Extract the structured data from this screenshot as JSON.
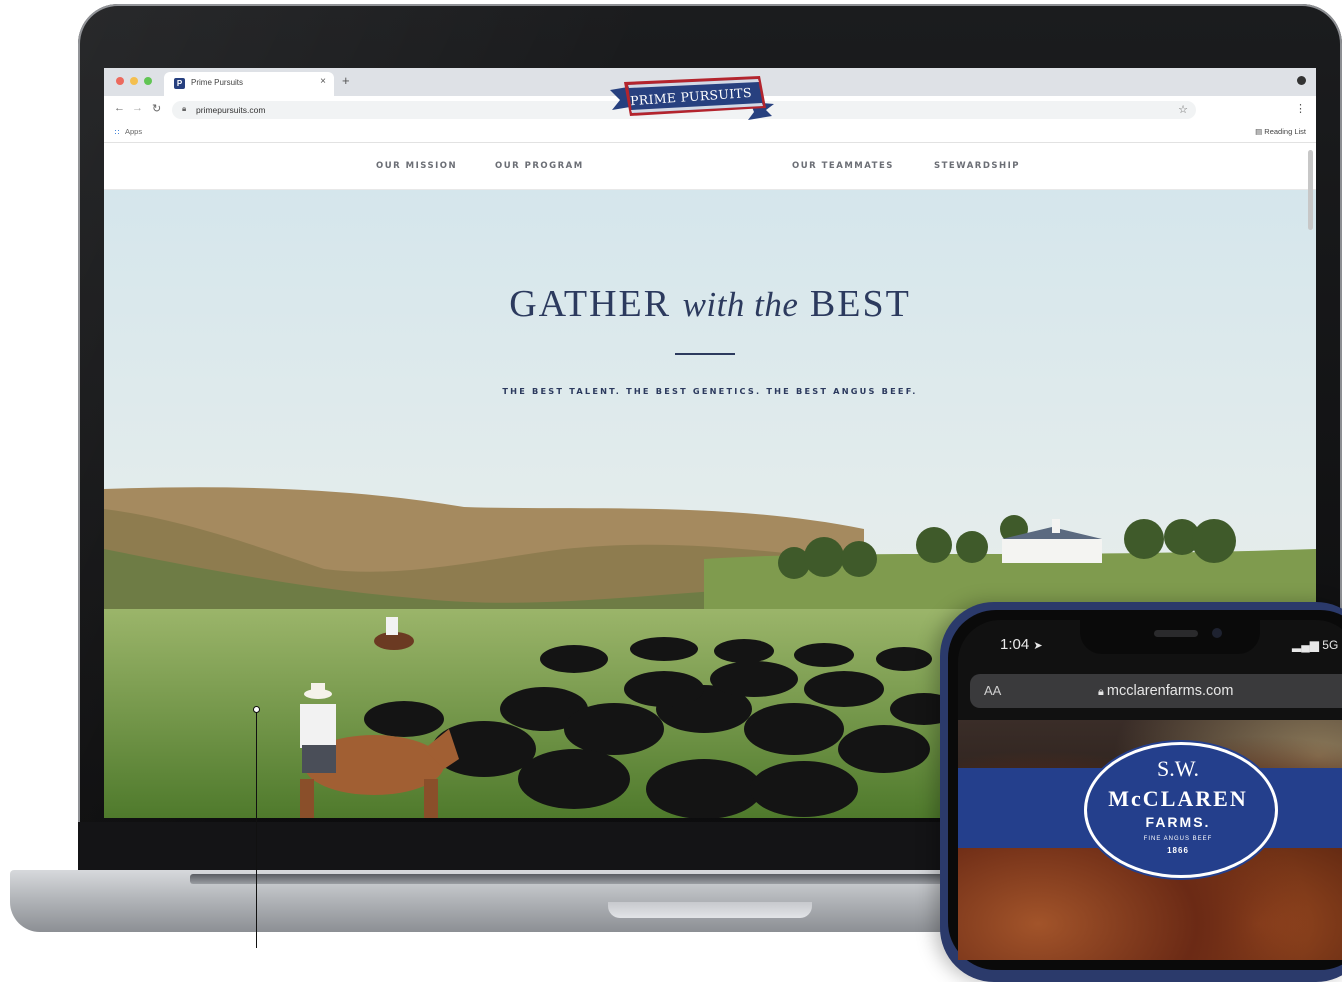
{
  "browser": {
    "tab_title": "Prime Pursuits",
    "tab_close": "×",
    "new_tab": "+",
    "url": "primepursuits.com",
    "bookmarks_apps": "Apps",
    "reading_list": "Reading List"
  },
  "site": {
    "nav": {
      "mission": "OUR MISSION",
      "program": "OUR PROGRAM",
      "teammates": "OUR TEAMMATES",
      "stewardship": "STEWARDSHIP"
    },
    "logo_text": "PRIME PURSUITS",
    "hero": {
      "title_part1": "GATHER ",
      "title_script": "with the",
      "title_part2": " BEST",
      "tagline": "THE BEST TALENT. THE BEST GENETICS. THE BEST ANGUS BEEF."
    }
  },
  "phone": {
    "time": "1:04",
    "network": "5G",
    "text_size_label": "AA",
    "url": "mcclarenfarms.com",
    "logo": {
      "line1": "S.W.",
      "line2": "McCLAREN",
      "line3": "FARMS.",
      "line4": "FINE ANGUS BEEF",
      "year": "1866"
    }
  },
  "colors": {
    "navy": "#2c3a5e",
    "logo_blue": "#27407f",
    "logo_red": "#b3242d",
    "phone_frame": "#2b3a6b",
    "badge_blue": "#243f8c"
  },
  "icons": [
    "back-arrow-icon",
    "forward-arrow-icon",
    "reload-icon",
    "lock-icon",
    "star-icon",
    "menu-icon",
    "apps-icon",
    "reading-list-icon",
    "location-icon",
    "signal-icon"
  ]
}
